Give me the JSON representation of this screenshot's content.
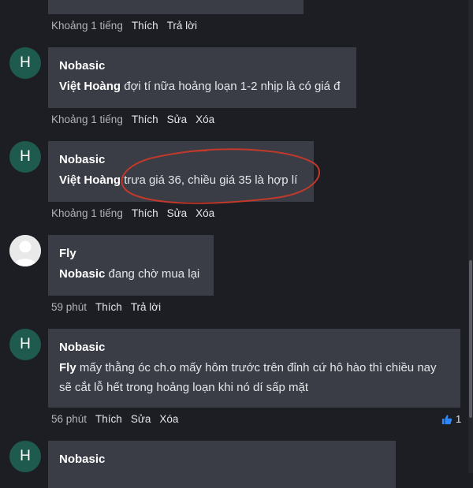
{
  "comments": [
    {
      "meta": {
        "time": "Khoảng 1 tiếng",
        "actions": [
          "Thích",
          "Trả lời"
        ]
      }
    },
    {
      "avatar_letter": "H",
      "author": "Nobasic",
      "mention": "Việt Hoàng",
      "text": " đợi tí nữa hoảng loạn 1-2 nhịp là có giá đ",
      "meta": {
        "time": "Khoảng 1 tiếng",
        "actions": [
          "Thích",
          "Sửa",
          "Xóa"
        ]
      }
    },
    {
      "avatar_letter": "H",
      "author": "Nobasic",
      "mention": "Việt Hoàng",
      "text": " trưa giá 36, chiều giá 35 là hợp lí",
      "meta": {
        "time": "Khoảng 1 tiếng",
        "actions": [
          "Thích",
          "Sửa",
          "Xóa"
        ]
      }
    },
    {
      "author": "Fly",
      "mention": "Nobasic",
      "text": " đang chờ mua lại",
      "meta": {
        "time": "59 phút",
        "actions": [
          "Thích",
          "Trả lời"
        ]
      }
    },
    {
      "avatar_letter": "H",
      "author": "Nobasic",
      "mention": "Fly",
      "text_line1": " mấy thằng óc ch.o mấy hôm trước trên đỉnh cứ hô hào thì chiều nay",
      "text_line2": "sẽ cắt lỗ hết trong hoảng loạn khi nó dí sấp mặt",
      "meta": {
        "time": "56 phút",
        "actions": [
          "Thích",
          "Sửa",
          "Xóa"
        ]
      },
      "likes": "1"
    },
    {
      "avatar_letter": "H",
      "author": "Nobasic"
    }
  ],
  "colors": {
    "background": "#1c1e24",
    "bubble": "#3a3d45",
    "avatar": "#1f5a4e",
    "annotation": "#c0392b",
    "like": "#2d88ff"
  },
  "icons": [
    "default-avatar-icon",
    "thumbs-up-icon"
  ]
}
